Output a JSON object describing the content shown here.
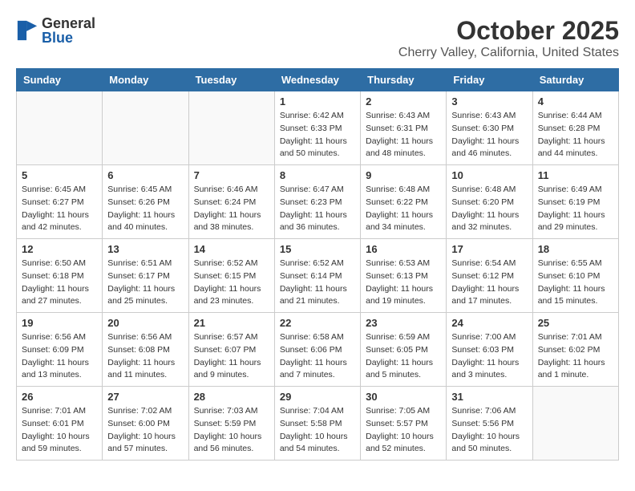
{
  "header": {
    "logo_general": "General",
    "logo_blue": "Blue",
    "month": "October 2025",
    "location": "Cherry Valley, California, United States"
  },
  "weekdays": [
    "Sunday",
    "Monday",
    "Tuesday",
    "Wednesday",
    "Thursday",
    "Friday",
    "Saturday"
  ],
  "weeks": [
    [
      {
        "day": "",
        "info": ""
      },
      {
        "day": "",
        "info": ""
      },
      {
        "day": "",
        "info": ""
      },
      {
        "day": "1",
        "info": "Sunrise: 6:42 AM\nSunset: 6:33 PM\nDaylight: 11 hours\nand 50 minutes."
      },
      {
        "day": "2",
        "info": "Sunrise: 6:43 AM\nSunset: 6:31 PM\nDaylight: 11 hours\nand 48 minutes."
      },
      {
        "day": "3",
        "info": "Sunrise: 6:43 AM\nSunset: 6:30 PM\nDaylight: 11 hours\nand 46 minutes."
      },
      {
        "day": "4",
        "info": "Sunrise: 6:44 AM\nSunset: 6:28 PM\nDaylight: 11 hours\nand 44 minutes."
      }
    ],
    [
      {
        "day": "5",
        "info": "Sunrise: 6:45 AM\nSunset: 6:27 PM\nDaylight: 11 hours\nand 42 minutes."
      },
      {
        "day": "6",
        "info": "Sunrise: 6:45 AM\nSunset: 6:26 PM\nDaylight: 11 hours\nand 40 minutes."
      },
      {
        "day": "7",
        "info": "Sunrise: 6:46 AM\nSunset: 6:24 PM\nDaylight: 11 hours\nand 38 minutes."
      },
      {
        "day": "8",
        "info": "Sunrise: 6:47 AM\nSunset: 6:23 PM\nDaylight: 11 hours\nand 36 minutes."
      },
      {
        "day": "9",
        "info": "Sunrise: 6:48 AM\nSunset: 6:22 PM\nDaylight: 11 hours\nand 34 minutes."
      },
      {
        "day": "10",
        "info": "Sunrise: 6:48 AM\nSunset: 6:20 PM\nDaylight: 11 hours\nand 32 minutes."
      },
      {
        "day": "11",
        "info": "Sunrise: 6:49 AM\nSunset: 6:19 PM\nDaylight: 11 hours\nand 29 minutes."
      }
    ],
    [
      {
        "day": "12",
        "info": "Sunrise: 6:50 AM\nSunset: 6:18 PM\nDaylight: 11 hours\nand 27 minutes."
      },
      {
        "day": "13",
        "info": "Sunrise: 6:51 AM\nSunset: 6:17 PM\nDaylight: 11 hours\nand 25 minutes."
      },
      {
        "day": "14",
        "info": "Sunrise: 6:52 AM\nSunset: 6:15 PM\nDaylight: 11 hours\nand 23 minutes."
      },
      {
        "day": "15",
        "info": "Sunrise: 6:52 AM\nSunset: 6:14 PM\nDaylight: 11 hours\nand 21 minutes."
      },
      {
        "day": "16",
        "info": "Sunrise: 6:53 AM\nSunset: 6:13 PM\nDaylight: 11 hours\nand 19 minutes."
      },
      {
        "day": "17",
        "info": "Sunrise: 6:54 AM\nSunset: 6:12 PM\nDaylight: 11 hours\nand 17 minutes."
      },
      {
        "day": "18",
        "info": "Sunrise: 6:55 AM\nSunset: 6:10 PM\nDaylight: 11 hours\nand 15 minutes."
      }
    ],
    [
      {
        "day": "19",
        "info": "Sunrise: 6:56 AM\nSunset: 6:09 PM\nDaylight: 11 hours\nand 13 minutes."
      },
      {
        "day": "20",
        "info": "Sunrise: 6:56 AM\nSunset: 6:08 PM\nDaylight: 11 hours\nand 11 minutes."
      },
      {
        "day": "21",
        "info": "Sunrise: 6:57 AM\nSunset: 6:07 PM\nDaylight: 11 hours\nand 9 minutes."
      },
      {
        "day": "22",
        "info": "Sunrise: 6:58 AM\nSunset: 6:06 PM\nDaylight: 11 hours\nand 7 minutes."
      },
      {
        "day": "23",
        "info": "Sunrise: 6:59 AM\nSunset: 6:05 PM\nDaylight: 11 hours\nand 5 minutes."
      },
      {
        "day": "24",
        "info": "Sunrise: 7:00 AM\nSunset: 6:03 PM\nDaylight: 11 hours\nand 3 minutes."
      },
      {
        "day": "25",
        "info": "Sunrise: 7:01 AM\nSunset: 6:02 PM\nDaylight: 11 hours\nand 1 minute."
      }
    ],
    [
      {
        "day": "26",
        "info": "Sunrise: 7:01 AM\nSunset: 6:01 PM\nDaylight: 10 hours\nand 59 minutes."
      },
      {
        "day": "27",
        "info": "Sunrise: 7:02 AM\nSunset: 6:00 PM\nDaylight: 10 hours\nand 57 minutes."
      },
      {
        "day": "28",
        "info": "Sunrise: 7:03 AM\nSunset: 5:59 PM\nDaylight: 10 hours\nand 56 minutes."
      },
      {
        "day": "29",
        "info": "Sunrise: 7:04 AM\nSunset: 5:58 PM\nDaylight: 10 hours\nand 54 minutes."
      },
      {
        "day": "30",
        "info": "Sunrise: 7:05 AM\nSunset: 5:57 PM\nDaylight: 10 hours\nand 52 minutes."
      },
      {
        "day": "31",
        "info": "Sunrise: 7:06 AM\nSunset: 5:56 PM\nDaylight: 10 hours\nand 50 minutes."
      },
      {
        "day": "",
        "info": ""
      }
    ]
  ]
}
